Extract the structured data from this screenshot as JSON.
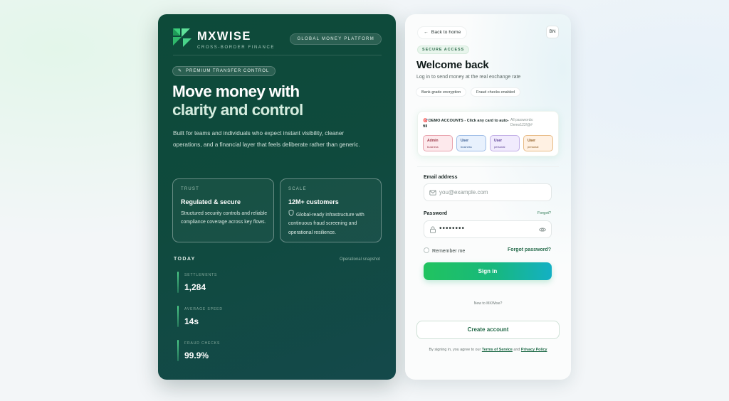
{
  "brand": {
    "name": "MXWISE",
    "tagline": "CROSS-BORDER FINANCE",
    "platform_badge": "GLOBAL MONEY PLATFORM"
  },
  "hero": {
    "pill": "PREMIUM TRANSFER CONTROL",
    "headline_line1": "Move money with",
    "headline_line2": "clarity and control",
    "subcopy": "Built for teams and individuals who expect instant visibility, cleaner operations, and a financial layer that feels deliberate rather than generic."
  },
  "cards": [
    {
      "kicker": "TRUST",
      "title": "Regulated & secure",
      "desc": "Structured security controls and reliable compliance coverage across key flows."
    },
    {
      "kicker": "SCALE",
      "title": "12M+ customers",
      "desc": "Global-ready infrastructure with continuous fraud screening and operational resilience."
    }
  ],
  "today": {
    "label": "TODAY",
    "snapshot": "Operational snapshot",
    "stats": [
      {
        "label": "SETTLEMENTS",
        "value": "1,284"
      },
      {
        "label": "AVERAGE SPEED",
        "value": "14s"
      },
      {
        "label": "FRAUD CHECKS",
        "value": "99.9%"
      }
    ]
  },
  "auth": {
    "back_label": "Back to home",
    "lang": "BN",
    "secure_pill": "SECURE ACCESS",
    "title": "Welcome back",
    "subtitle": "Log in to send money at the real exchange rate",
    "chips": [
      "Bank-grade encryption",
      "Fraud checks enabled"
    ],
    "demo": {
      "title": "DEMO ACCOUNTS - Click any card to auto-fill",
      "password_note_line1": "All passwords:",
      "password_note_line2": "Demo123!@#",
      "roles": [
        {
          "name": "Admin",
          "sub": "business"
        },
        {
          "name": "User",
          "sub": "business"
        },
        {
          "name": "User",
          "sub": "personal"
        },
        {
          "name": "User",
          "sub": "personal"
        }
      ]
    },
    "email_label": "Email address",
    "email_placeholder": "you@example.com",
    "password_label": "Password",
    "forgot_small": "Forgot?",
    "password_mask": "••••••••",
    "remember_label": "Remember me",
    "forgot_label": "Forgot password?",
    "signin_label": "Sign in",
    "new_to": "New to MXWise?",
    "create_label": "Create account",
    "terms_prefix": "By signing in, you agree to our",
    "terms_link": "Terms of Service",
    "terms_and": "and",
    "privacy_link": "Privacy Policy"
  },
  "colors": {
    "panel_dark": "#0f4a3d",
    "accent_green": "#21c35f",
    "accent_teal": "#14b0c4"
  },
  "icons": [
    "logo-mark",
    "spark-icon",
    "shield-icon",
    "arrow-left-icon",
    "mail-icon",
    "lock-icon",
    "eye-icon",
    "demo-icon"
  ]
}
